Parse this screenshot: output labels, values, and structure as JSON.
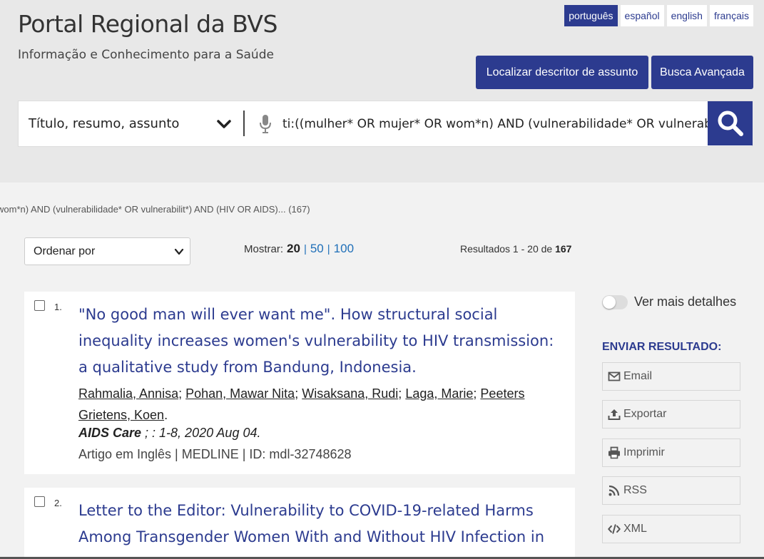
{
  "header": {
    "title": "Portal Regional da BVS",
    "subtitle": "Informação e Conhecimento para a Saúde",
    "languages": [
      {
        "label": "português",
        "active": true
      },
      {
        "label": "español",
        "active": false
      },
      {
        "label": "english",
        "active": false
      },
      {
        "label": "français",
        "active": false
      }
    ],
    "descritor_button": "Localizar descritor de assunto",
    "advanced_button": "Busca Avançada"
  },
  "search": {
    "field": "Título, resumo, assunto",
    "query": "ti:((mulher* OR mujer* OR wom*n) AND (vulnerabilidade* OR vulnerabilit*) AND (HIV OR AIDS))",
    "icons": {
      "dropdown": "chevron-down-icon",
      "mic": "microphone-icon",
      "submit": "search-icon"
    }
  },
  "query_echo": "wom*n) AND (vulnerabilidade* OR vulnerabilit*) AND (HIV OR AIDS)... (167)",
  "controls": {
    "order_label": "Ordenar por",
    "mostrar_label": "Mostrar:",
    "page_sizes": [
      "20",
      "50",
      "100"
    ],
    "separator": "|",
    "resultados_prefix": "Resultados 1 - 20 de",
    "resultados_total": "167"
  },
  "results": [
    {
      "num": "1.",
      "title": "\"No good man will ever want me\". How structural social inequality increases women's vulnerability to HIV transmission: a qualitative study from Bandung, Indonesia.",
      "authors": [
        "Rahmalia, Annisa",
        "Pohan, Mawar Nita",
        "Wisaksana, Rudi",
        "Laga, Marie",
        "Peeters Grietens, Koen"
      ],
      "author_sep": ";",
      "authors_end": ".",
      "journal": "AIDS Care",
      "journal_rest": " ; : 1-8, 2020 Aug 04.",
      "meta": "Artigo em Inglês | MEDLINE | ID: mdl-32748628"
    },
    {
      "num": "2.",
      "title": "Letter to the Editor: Vulnerability to COVID-19-related Harms Among Transgender Women With and Without HIV Infection in"
    }
  ],
  "sidebar": {
    "toggle_label": "Ver mais detalhes",
    "toggle_on": false,
    "enviar_title": "ENVIAR RESULTADO:",
    "actions": [
      {
        "label": "Email",
        "icon": "envelope-icon"
      },
      {
        "label": "Exportar",
        "icon": "upload-icon"
      },
      {
        "label": "Imprimir",
        "icon": "printer-icon"
      },
      {
        "label": "RSS",
        "icon": "rss-icon"
      },
      {
        "label": "XML",
        "icon": "code-icon"
      }
    ]
  },
  "colors": {
    "primary": "#2c3b8f",
    "link": "#1f6fb8",
    "header_bg": "#e8e8e8",
    "page_bg": "#f2f2f2"
  }
}
